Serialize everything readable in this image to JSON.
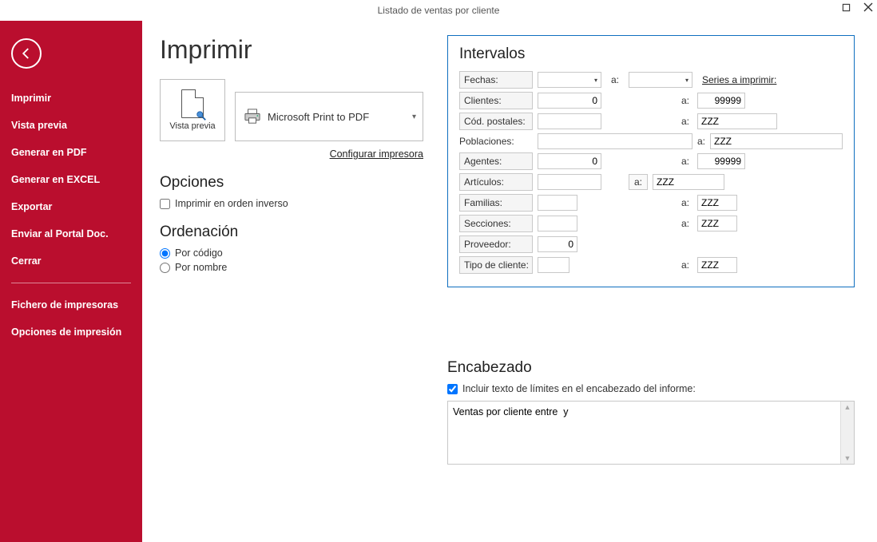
{
  "titlebar": {
    "title": "Listado de ventas por cliente"
  },
  "sidebar": {
    "items": [
      "Imprimir",
      "Vista previa",
      "Generar en PDF",
      "Generar en EXCEL",
      "Exportar",
      "Enviar al Portal Doc.",
      "Cerrar"
    ],
    "items2": [
      "Fichero de impresoras",
      "Opciones de impresión"
    ]
  },
  "page": {
    "title": "Imprimir",
    "preview_label": "Vista previa",
    "printer_name": "Microsoft Print to PDF",
    "configure": "Configurar impresora",
    "options_heading": "Opciones",
    "reverse_label": "Imprimir en orden inverso",
    "sort_heading": "Ordenación",
    "sort_code": "Por código",
    "sort_name": "Por nombre"
  },
  "intervalos": {
    "heading": "Intervalos",
    "a_label": "a:",
    "series_link": "Series a imprimir:",
    "fechas_lbl": "Fechas:",
    "fechas_from": "",
    "fechas_to": "",
    "clientes_lbl": "Clientes:",
    "clientes_from": "0",
    "clientes_to": "99999",
    "cp_lbl": "Cód. postales:",
    "cp_from": "",
    "cp_to": "ZZZ",
    "poblaciones_lbl": "Poblaciones:",
    "poblaciones_from": "",
    "poblaciones_to": "ZZZ",
    "agentes_lbl": "Agentes:",
    "agentes_from": "0",
    "agentes_to": "99999",
    "articulos_lbl": "Artículos:",
    "articulos_from": "",
    "articulos_to": "ZZZ",
    "familias_lbl": "Familias:",
    "familias_from": "",
    "familias_to": "ZZZ",
    "secciones_lbl": "Secciones:",
    "secciones_from": "",
    "secciones_to": "ZZZ",
    "proveedor_lbl": "Proveedor:",
    "proveedor_from": "0",
    "tipocli_lbl": "Tipo de cliente:",
    "tipocli_from": "",
    "tipocli_to": "ZZZ"
  },
  "encabezado": {
    "heading": "Encabezado",
    "chk_label": "Incluir texto de límites en el encabezado del informe:",
    "text": "Ventas por cliente entre  y"
  }
}
